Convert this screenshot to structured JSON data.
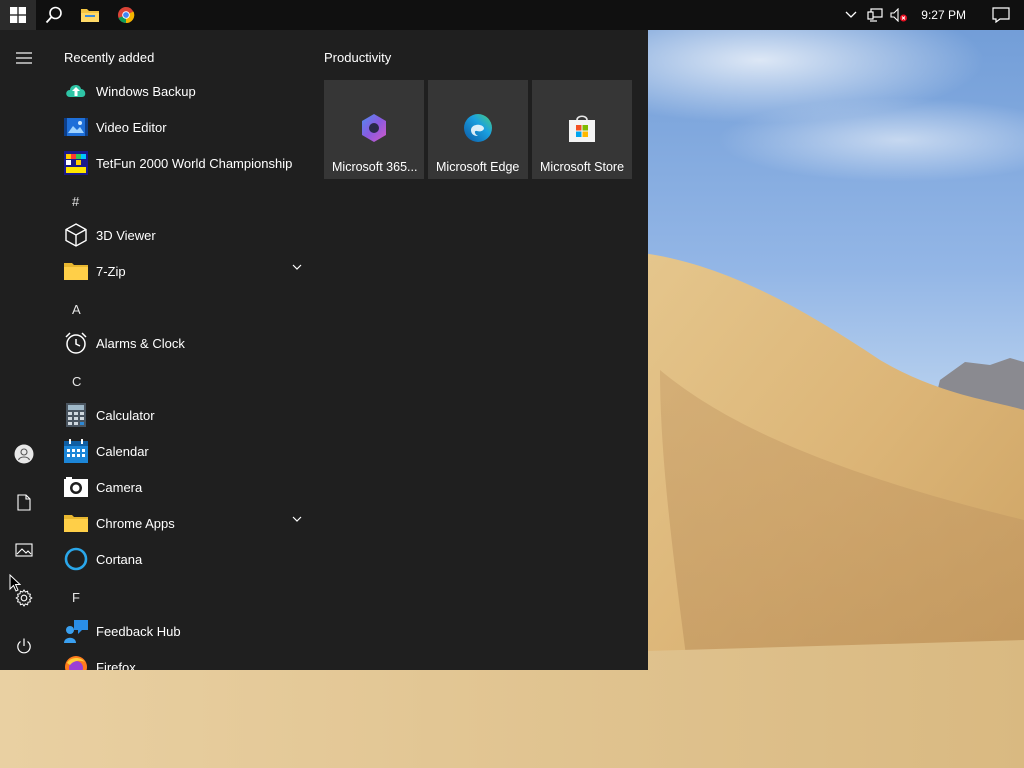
{
  "taskbar": {
    "start_icon": "windows-logo-icon",
    "search_icon": "search-icon",
    "pinned": [
      {
        "name": "file-explorer-icon"
      },
      {
        "name": "chrome-icon"
      }
    ],
    "tray": {
      "clock": "9:27 PM"
    }
  },
  "start_menu": {
    "rail": {
      "icons": [
        "hamburger-menu-icon",
        "user-icon",
        "documents-icon",
        "pictures-icon",
        "settings-icon",
        "power-icon"
      ]
    },
    "recently_added_label": "Recently added",
    "recent_items": [
      {
        "label": "Windows Backup",
        "icon": "windows-backup-icon"
      },
      {
        "label": "Video Editor",
        "icon": "video-editor-icon"
      },
      {
        "label": "TetFun 2000 World Championship",
        "icon": "tetfun-icon"
      }
    ],
    "sections": [
      {
        "letter": "#",
        "items": [
          {
            "label": "3D Viewer",
            "icon": "3d-viewer-icon"
          },
          {
            "label": "7-Zip",
            "icon": "folder-icon",
            "expandable": true
          }
        ]
      },
      {
        "letter": "A",
        "items": [
          {
            "label": "Alarms & Clock",
            "icon": "alarm-clock-icon"
          }
        ]
      },
      {
        "letter": "C",
        "items": [
          {
            "label": "Calculator",
            "icon": "calculator-icon"
          },
          {
            "label": "Calendar",
            "icon": "calendar-icon"
          },
          {
            "label": "Camera",
            "icon": "camera-icon"
          },
          {
            "label": "Chrome Apps",
            "icon": "folder-icon",
            "expandable": true
          },
          {
            "label": "Cortana",
            "icon": "cortana-icon"
          }
        ]
      },
      {
        "letter": "F",
        "items": [
          {
            "label": "Feedback Hub",
            "icon": "feedback-hub-icon"
          },
          {
            "label": "Firefox",
            "icon": "firefox-icon"
          }
        ]
      }
    ],
    "tile_group": {
      "title": "Productivity",
      "tiles": [
        {
          "label": "Microsoft 365...",
          "icon": "microsoft-365-icon"
        },
        {
          "label": "Microsoft Edge",
          "icon": "edge-icon"
        },
        {
          "label": "Microsoft Store",
          "icon": "store-icon"
        }
      ]
    }
  },
  "colors": {
    "taskbar_bg": "#101010",
    "start_bg": "#1f1f1f",
    "tile_bg": "#363636",
    "accent": "#0078d7"
  }
}
